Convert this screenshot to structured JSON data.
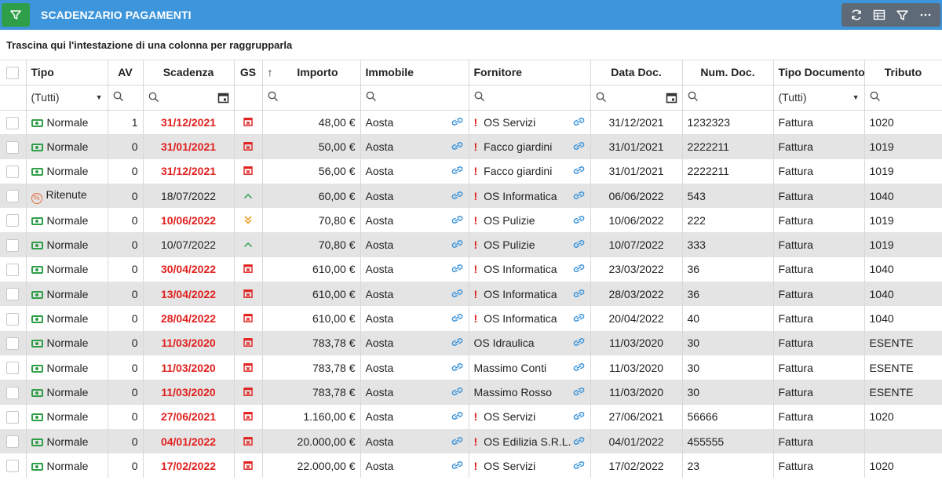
{
  "app": {
    "title": "SCADENZARIO PAGAMENTI"
  },
  "toolbar": {
    "icons": [
      "refresh-icon",
      "grid-icon",
      "filter-icon",
      "more-icon"
    ]
  },
  "group_panel": {
    "text": "Trascina qui l'intestazione di una colonna per raggrupparla"
  },
  "columns": {
    "tipo": "Tipo",
    "av": "AV",
    "scadenza": "Scadenza",
    "gs": "GS",
    "sort": "↑",
    "importo": "Importo",
    "immobile": "Immobile",
    "fornitore": "Fornitore",
    "data_doc": "Data Doc.",
    "num_doc": "Num. Doc.",
    "tipo_documento": "Tipo Documento",
    "tributo": "Tributo"
  },
  "filters": {
    "tipo": "(Tutti)",
    "tipo_documento": "(Tutti)"
  },
  "colors": {
    "header_bar": "#3d95db",
    "filter_button": "#2e9e48",
    "overdue": "#e0201e",
    "alt_row": "#e4e4e4"
  },
  "rows": [
    {
      "tipo": "Normale",
      "av": "1",
      "scadenza": "31/12/2021",
      "overdue": true,
      "gs": "calendar-x-icon",
      "importo": "48,00 €",
      "immobile": "Aosta",
      "warn": true,
      "fornitore": "OS Servizi",
      "data_doc": "31/12/2021",
      "num_doc": "1232323",
      "tipo_documento": "Fattura",
      "tributo": "1020"
    },
    {
      "tipo": "Normale",
      "av": "0",
      "scadenza": "31/01/2021",
      "overdue": true,
      "gs": "calendar-x-icon",
      "importo": "50,00 €",
      "immobile": "Aosta",
      "warn": true,
      "fornitore": "Facco giardini",
      "data_doc": "31/01/2021",
      "num_doc": "2222211",
      "tipo_documento": "Fattura",
      "tributo": "1019"
    },
    {
      "tipo": "Normale",
      "av": "0",
      "scadenza": "31/12/2021",
      "overdue": true,
      "gs": "calendar-x-icon",
      "importo": "56,00 €",
      "immobile": "Aosta",
      "warn": true,
      "fornitore": "Facco giardini",
      "data_doc": "31/01/2021",
      "num_doc": "2222211",
      "tipo_documento": "Fattura",
      "tributo": "1019"
    },
    {
      "tipo": "Ritenute",
      "av": "0",
      "scadenza": "18/07/2022",
      "overdue": false,
      "gs": "chevron-up-icon",
      "importo": "60,00 €",
      "immobile": "Aosta",
      "warn": true,
      "fornitore": "OS Informatica",
      "data_doc": "06/06/2022",
      "num_doc": "543",
      "tipo_documento": "Fattura",
      "tributo": "1040"
    },
    {
      "tipo": "Normale",
      "av": "0",
      "scadenza": "10/06/2022",
      "overdue": true,
      "gs": "double-chevron-down-icon",
      "importo": "70,80 €",
      "immobile": "Aosta",
      "warn": true,
      "fornitore": "OS Pulizie",
      "data_doc": "10/06/2022",
      "num_doc": "222",
      "tipo_documento": "Fattura",
      "tributo": "1019"
    },
    {
      "tipo": "Normale",
      "av": "0",
      "scadenza": "10/07/2022",
      "overdue": false,
      "gs": "chevron-up-icon",
      "importo": "70,80 €",
      "immobile": "Aosta",
      "warn": true,
      "fornitore": "OS Pulizie",
      "data_doc": "10/07/2022",
      "num_doc": "333",
      "tipo_documento": "Fattura",
      "tributo": "1019"
    },
    {
      "tipo": "Normale",
      "av": "0",
      "scadenza": "30/04/2022",
      "overdue": true,
      "gs": "calendar-x-icon",
      "importo": "610,00 €",
      "immobile": "Aosta",
      "warn": true,
      "fornitore": "OS Informatica",
      "data_doc": "23/03/2022",
      "num_doc": "36",
      "tipo_documento": "Fattura",
      "tributo": "1040"
    },
    {
      "tipo": "Normale",
      "av": "0",
      "scadenza": "13/04/2022",
      "overdue": true,
      "gs": "calendar-x-icon",
      "importo": "610,00 €",
      "immobile": "Aosta",
      "warn": true,
      "fornitore": "OS Informatica",
      "data_doc": "28/03/2022",
      "num_doc": "36",
      "tipo_documento": "Fattura",
      "tributo": "1040"
    },
    {
      "tipo": "Normale",
      "av": "0",
      "scadenza": "28/04/2022",
      "overdue": true,
      "gs": "calendar-x-icon",
      "importo": "610,00 €",
      "immobile": "Aosta",
      "warn": true,
      "fornitore": "OS Informatica",
      "data_doc": "20/04/2022",
      "num_doc": "40",
      "tipo_documento": "Fattura",
      "tributo": "1040"
    },
    {
      "tipo": "Normale",
      "av": "0",
      "scadenza": "11/03/2020",
      "overdue": true,
      "gs": "calendar-x-icon",
      "importo": "783,78 €",
      "immobile": "Aosta",
      "warn": false,
      "fornitore": "OS Idraulica",
      "data_doc": "11/03/2020",
      "num_doc": "30",
      "tipo_documento": "Fattura",
      "tributo": "ESENTE"
    },
    {
      "tipo": "Normale",
      "av": "0",
      "scadenza": "11/03/2020",
      "overdue": true,
      "gs": "calendar-x-icon",
      "importo": "783,78 €",
      "immobile": "Aosta",
      "warn": false,
      "fornitore": "Massimo Conti",
      "data_doc": "11/03/2020",
      "num_doc": "30",
      "tipo_documento": "Fattura",
      "tributo": "ESENTE"
    },
    {
      "tipo": "Normale",
      "av": "0",
      "scadenza": "11/03/2020",
      "overdue": true,
      "gs": "calendar-x-icon",
      "importo": "783,78 €",
      "immobile": "Aosta",
      "warn": false,
      "fornitore": "Massimo Rosso",
      "data_doc": "11/03/2020",
      "num_doc": "30",
      "tipo_documento": "Fattura",
      "tributo": "ESENTE"
    },
    {
      "tipo": "Normale",
      "av": "0",
      "scadenza": "27/06/2021",
      "overdue": true,
      "gs": "calendar-x-icon",
      "importo": "1.160,00 €",
      "immobile": "Aosta",
      "warn": true,
      "fornitore": "OS Servizi",
      "data_doc": "27/06/2021",
      "num_doc": "56666",
      "tipo_documento": "Fattura",
      "tributo": "1020"
    },
    {
      "tipo": "Normale",
      "av": "0",
      "scadenza": "04/01/2022",
      "overdue": true,
      "gs": "calendar-x-icon",
      "importo": "20.000,00 €",
      "immobile": "Aosta",
      "warn": true,
      "fornitore": "OS Edilizia S.R.L.",
      "data_doc": "04/01/2022",
      "num_doc": "455555",
      "tipo_documento": "Fattura",
      "tributo": ""
    },
    {
      "tipo": "Normale",
      "av": "0",
      "scadenza": "17/02/2022",
      "overdue": true,
      "gs": "calendar-x-icon",
      "importo": "22.000,00 €",
      "immobile": "Aosta",
      "warn": true,
      "fornitore": "OS Servizi",
      "data_doc": "17/02/2022",
      "num_doc": "23",
      "tipo_documento": "Fattura",
      "tributo": "1020"
    }
  ]
}
